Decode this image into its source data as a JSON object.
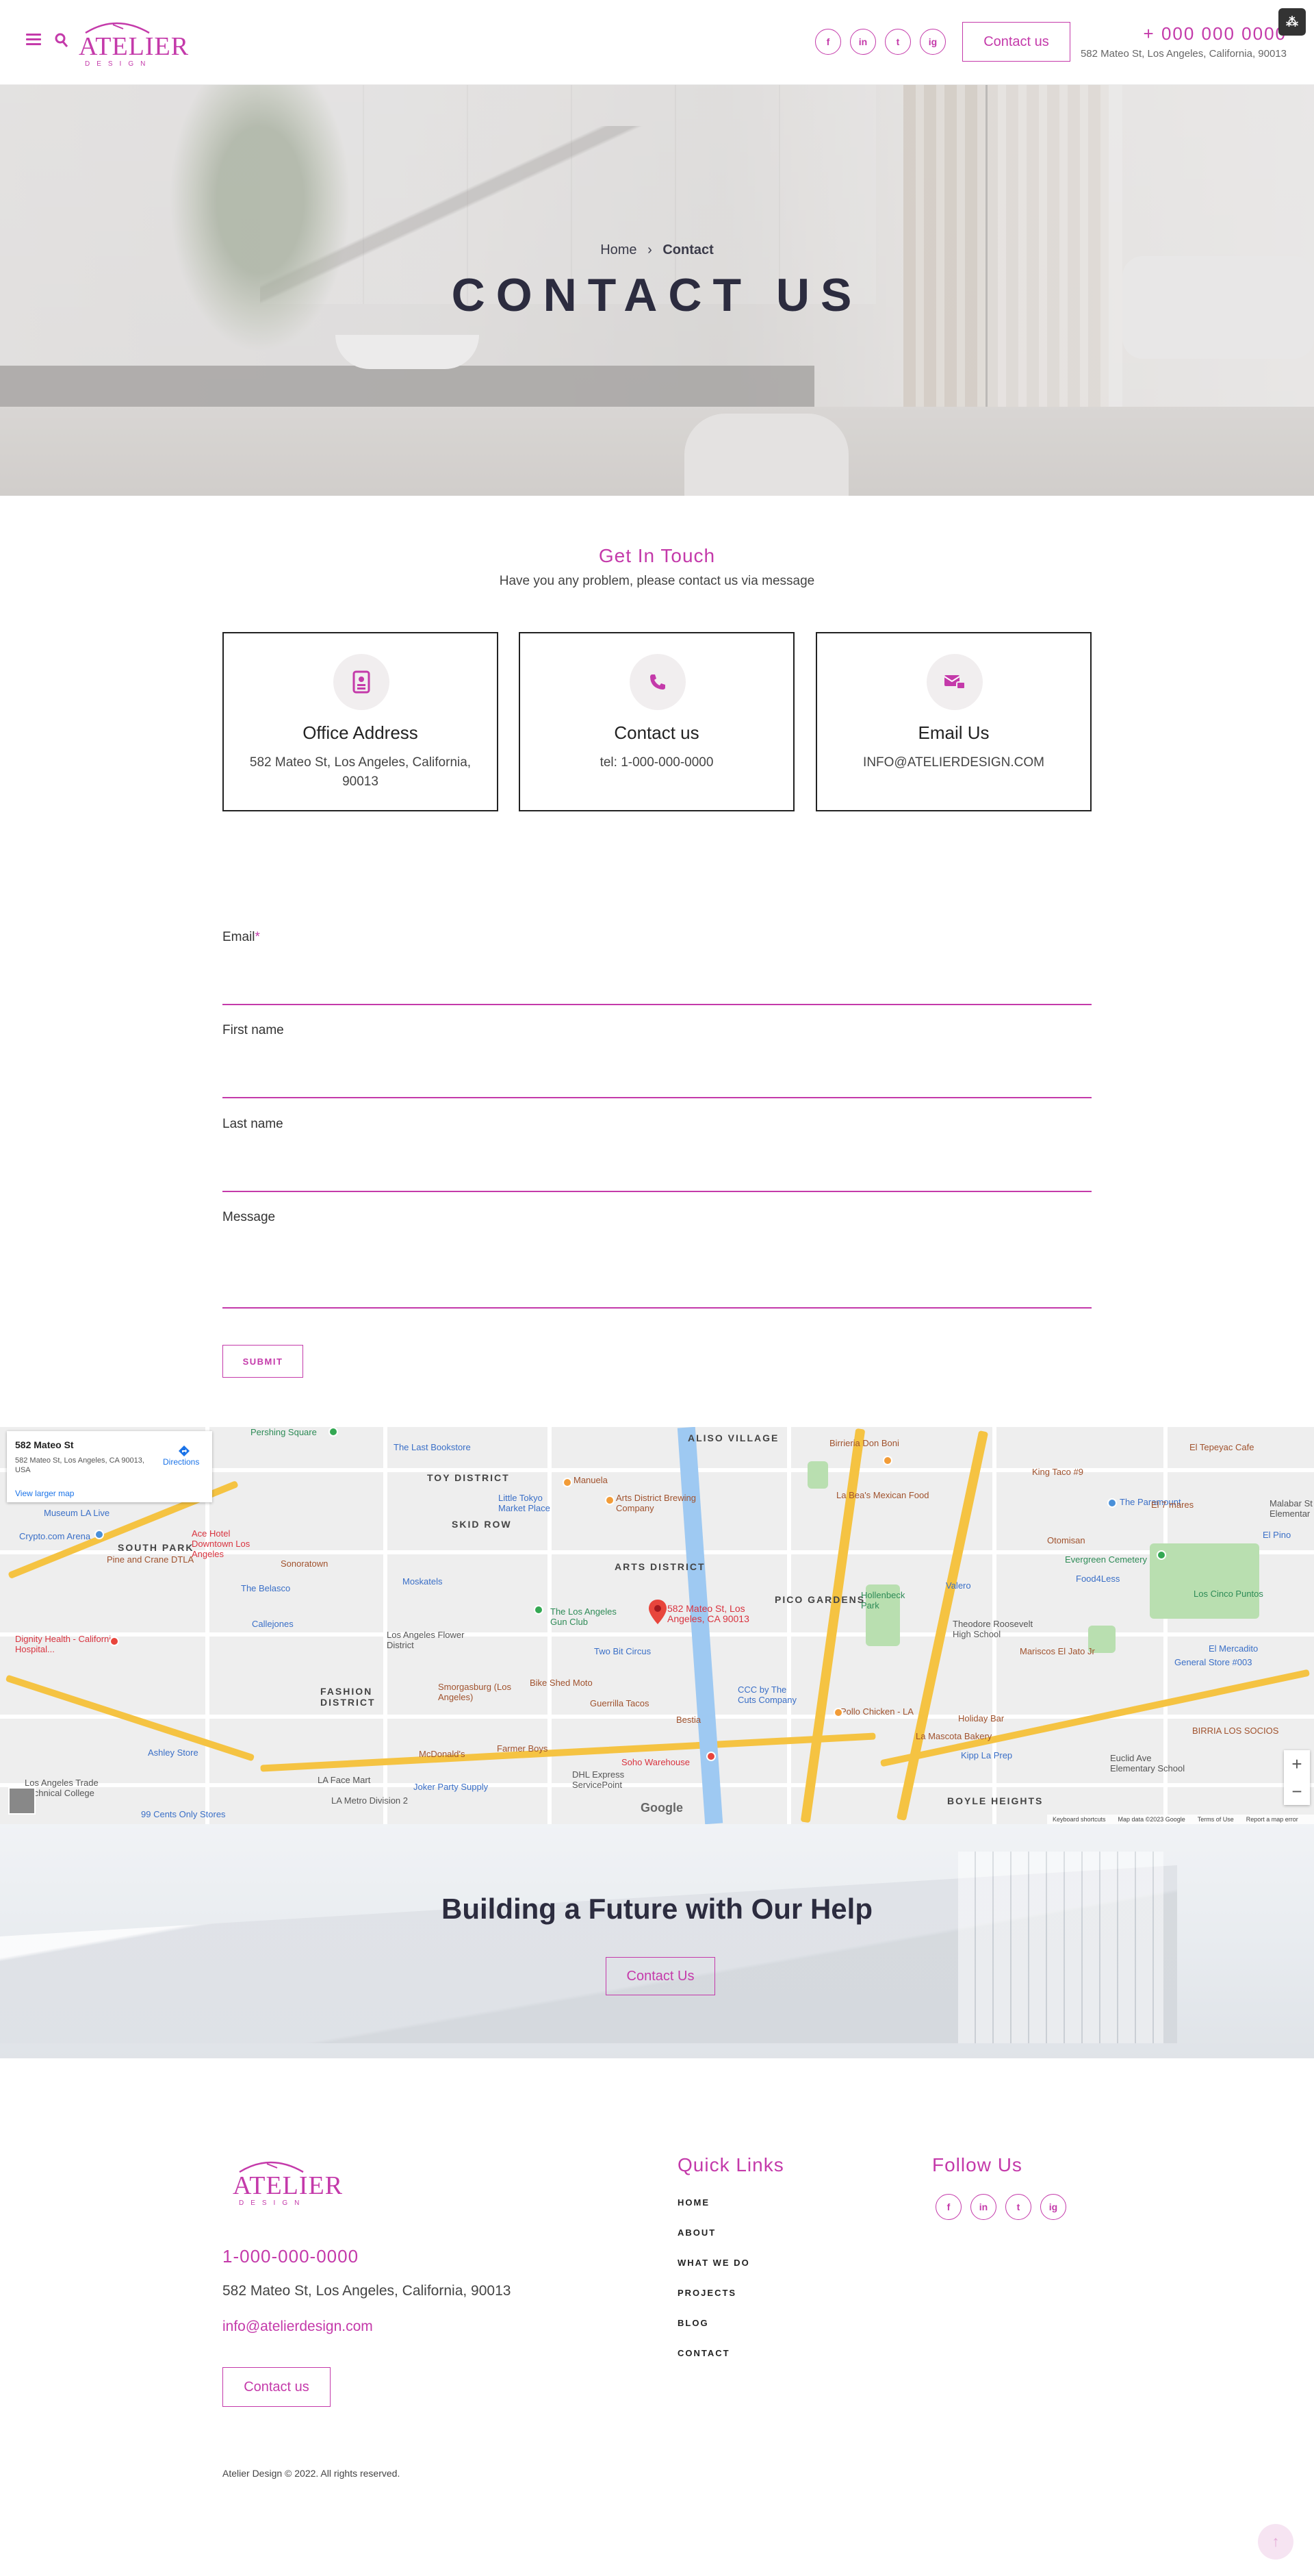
{
  "header": {
    "logo_text": "ATELIER",
    "logo_sub": "DESIGN",
    "social": [
      "f",
      "in",
      "t",
      "ig"
    ],
    "contact_button": "Contact us",
    "phone": "+ 000 000 0000",
    "address": "582 Mateo St, Los Angeles, California, 90013"
  },
  "hero": {
    "breadcrumb_home": "Home",
    "breadcrumb_sep": "›",
    "breadcrumb_current": "Contact",
    "title": "CONTACT US"
  },
  "get_in_touch": {
    "title": "Get In Touch",
    "subtitle": "Have you any problem, please contact us via message",
    "cards": [
      {
        "icon": "address-book-icon",
        "title": "Office Address",
        "text": "582 Mateo St, Los Angeles, California, 90013"
      },
      {
        "icon": "phone-icon",
        "title": "Contact us",
        "text": "tel: 1-000-000-0000"
      },
      {
        "icon": "mail-icon",
        "title": "Email Us",
        "text": "INFO@ATELIERDESIGN.COM"
      }
    ]
  },
  "form": {
    "email_label": "Email",
    "required_mark": "*",
    "first_name_label": "First name",
    "last_name_label": "Last name",
    "message_label": "Message",
    "submit_label": "SUBMIT"
  },
  "map": {
    "info_title": "582 Mateo St",
    "info_address": "582 Mateo St, Los Angeles, CA 90013, USA",
    "directions": "Directions",
    "view_larger": "View larger map",
    "pin_label_1": "582 Mateo St, Los",
    "pin_label_2": "Angeles, CA 90013",
    "google": "Google",
    "footer_items": [
      "Keyboard shortcuts",
      "Map data ©2023 Google",
      "Terms of Use",
      "Report a map error"
    ],
    "labels": {
      "aliso_village": "ALISO VILLAGE",
      "toy_district": "TOY DISTRICT",
      "skid_row": "SKID ROW",
      "arts_district": "ARTS DISTRICT",
      "south_park": "SOUTH PARK",
      "pico_gardens": "PICO GARDENS",
      "fashion_district": "FASHION DISTRICT",
      "boyle_heights": "BOYLE HEIGHTS",
      "pershing_square": "Pershing Square",
      "last_bookstore": "The Last Bookstore",
      "little_tokyo": "Little Tokyo Market Place",
      "manuela": "Manuela",
      "arts_brewing": "Arts District Brewing Company",
      "birrieria": "Birrieria Don Boni",
      "el_tepeyac": "El Tepeyac Cafe",
      "king_taco": "King Taco #9",
      "the_paramount": "The Paramount",
      "el_7_mares": "El 7 mares",
      "malabar": "Malabar St Elementar",
      "el_pino": "El Pino",
      "evergreen": "Evergreen Cemetery",
      "la_bea": "La Bea's Mexican Food",
      "otomisan": "Otomisan",
      "crypto_arena": "Crypto.com Arena",
      "ace_hotel": "Ace Hotel Downtown Los Angeles",
      "sonoratown": "Sonoratown",
      "belasco": "The Belasco",
      "mosaic": "Moskatels",
      "gun_club": "The Los Angeles Gun Club",
      "two_bit": "Two Bit Circus",
      "hollenbeck": "Hollenbeck Park",
      "valero": "Valero",
      "food4less": "Food4Less",
      "teddy": "Theodore Roosevelt High School",
      "mariscos": "Mariscos El Jato Jr",
      "el_mercadito": "El Mercadito",
      "general_store": "General Store #003",
      "los_cinco": "Los Cinco Puntos",
      "callejones": "Callejones",
      "flower_district": "Los Angeles Flower District",
      "smorgasburg": "Smorgasburg (Los Angeles)",
      "bike_shed": "Bike Shed Moto",
      "guerrilla": "Guerrilla Tacos",
      "bestia": "Bestia",
      "ccc": "CCC by The Cuts Company",
      "pollo": "Pollo Chicken - LA",
      "la_mascota": "La Mascota Bakery",
      "holiday": "Holiday Bar",
      "kipp": "Kipp La Prep",
      "euclid": "Euclid Ave Elementary School",
      "birria_los_socios": "BIRRIA LOS SOCIOS",
      "dignity": "Dignity Health - California Hospital...",
      "pine_crane": "Pine and Crane DTLA",
      "museum": "Museum LA Live",
      "mcdonalds": "McDonald's",
      "farmer_boys": "Farmer Boys",
      "soho": "Soho Warehouse",
      "dhl": "DHL Express ServicePoint",
      "la_face": "LA Face Mart",
      "joker": "Joker Party Supply",
      "metro": "LA Metro Division 2",
      "ninety_nine": "99 Cents Only Stores",
      "ashley": "Ashley Store",
      "la_trade": "Los Angeles Trade Technical College"
    }
  },
  "cta": {
    "title": "Building a Future with Our Help",
    "button": "Contact Us"
  },
  "footer": {
    "phone": "1-000-000-0000",
    "address": "582 Mateo St, Los Angeles, California, 90013",
    "email": "info@atelierdesign.com",
    "contact_button": "Contact us",
    "quick_links_title": "Quick Links",
    "quick_links": [
      "HOME",
      "ABOUT",
      "WHAT WE DO",
      "PROJECTS",
      "BLOG",
      "CONTACT"
    ],
    "follow_title": "Follow Us",
    "copyright": "Atelier Design © 2022. All rights reserved."
  },
  "colors": {
    "accent": "#c43aaa",
    "text_dark": "#2c2c3f"
  }
}
